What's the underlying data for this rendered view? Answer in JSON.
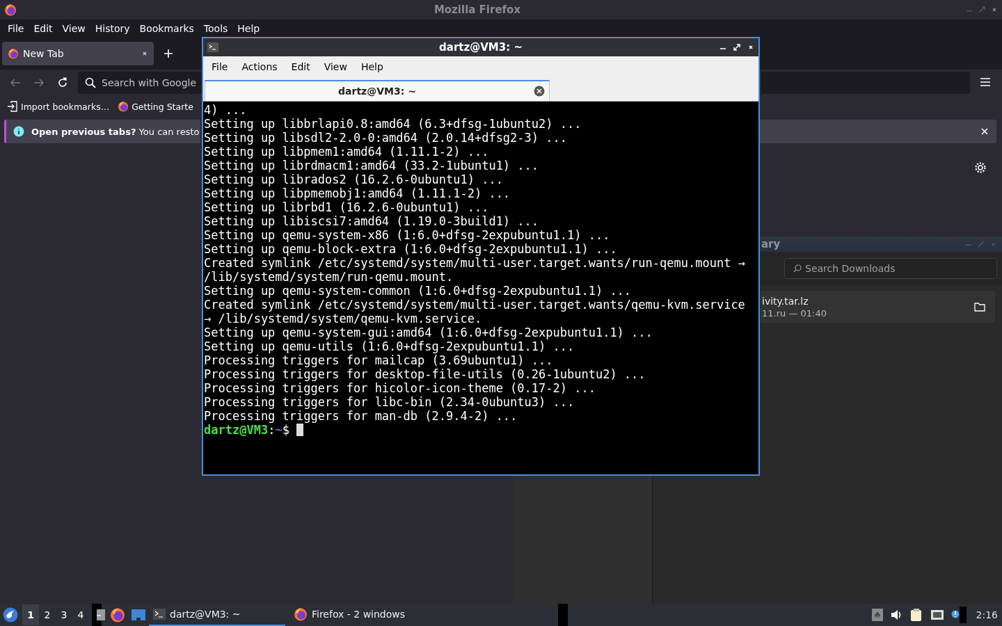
{
  "firefox": {
    "title": "Mozilla Firefox",
    "menu": [
      {
        "label": "File"
      },
      {
        "label": "Edit"
      },
      {
        "label": "View"
      },
      {
        "label": "History"
      },
      {
        "label": "Bookmarks"
      },
      {
        "label": "Tools"
      },
      {
        "label": "Help"
      }
    ],
    "tabs": [
      {
        "label": "New Tab",
        "selected": true
      }
    ],
    "url_placeholder": "Search with Google",
    "bookmarks": [
      {
        "label": "Import bookmarks…",
        "kind": "import"
      },
      {
        "label": "Getting Starte",
        "kind": "firefox"
      }
    ],
    "notification": "**Open previous tabs?** You can resto"
  },
  "library": {
    "title": "ary",
    "search_placeholder": "Search Downloads",
    "downloads": [
      {
        "name": "ivity.tar.lz",
        "detail": "11.ru — 01:40"
      }
    ]
  },
  "terminal": {
    "title": "dartz@VM3: ~",
    "menu": [
      {
        "label": "File"
      },
      {
        "label": "Actions"
      },
      {
        "label": "Edit"
      },
      {
        "label": "View"
      },
      {
        "label": "Help"
      }
    ],
    "tabs": [
      {
        "label": "dartz@VM3: ~",
        "selected": true
      }
    ],
    "lines": [
      "4) ...",
      "Setting up libbrlapi0.8:amd64 (6.3+dfsg-1ubuntu2) ...",
      "Setting up libsdl2-2.0-0:amd64 (2.0.14+dfsg2-3) ...",
      "Setting up libpmem1:amd64 (1.11.1-2) ...",
      "Setting up librdmacm1:amd64 (33.2-1ubuntu1) ...",
      "Setting up librados2 (16.2.6-0ubuntu1) ...",
      "Setting up libpmemobj1:amd64 (1.11.1-2) ...",
      "Setting up librbd1 (16.2.6-0ubuntu1) ...",
      "Setting up libiscsi7:amd64 (1.19.0-3build1) ...",
      "Setting up qemu-system-x86 (1:6.0+dfsg-2expubuntu1.1) ...",
      "Setting up qemu-block-extra (1:6.0+dfsg-2expubuntu1.1) ...",
      "Created symlink /etc/systemd/system/multi-user.target.wants/run-qemu.mount →",
      "/lib/systemd/system/run-qemu.mount.",
      "Setting up qemu-system-common (1:6.0+dfsg-2expubuntu1.1) ...",
      "Created symlink /etc/systemd/system/multi-user.target.wants/qemu-kvm.service",
      "→ /lib/systemd/system/qemu-kvm.service.",
      "Setting up qemu-system-gui:amd64 (1:6.0+dfsg-2expubuntu1.1) ...",
      "Setting up qemu-utils (1:6.0+dfsg-2expubuntu1.1) ...",
      "Processing triggers for mailcap (3.69ubuntu1) ...",
      "Processing triggers for desktop-file-utils (0.26-1ubuntu2) ...",
      "Processing triggers for hicolor-icon-theme (0.17-2) ...",
      "Processing triggers for libc-bin (2.34-0ubuntu3) ...",
      "Processing triggers for man-db (2.9.4-2) ..."
    ],
    "prompt": {
      "user": "dartz@VM3",
      "sep": ":",
      "path": "~",
      "symbol": "$"
    }
  },
  "taskbar": {
    "workspaces": [
      {
        "label": "1",
        "selected": true
      },
      {
        "label": "2",
        "selected": false
      },
      {
        "label": "3",
        "selected": false
      },
      {
        "label": "4",
        "selected": false
      }
    ],
    "tasks": [
      {
        "label": "dartz@VM3: ~",
        "kind": "terminal",
        "selected": true
      },
      {
        "label": "Firefox - 2 windows",
        "kind": "firefox",
        "selected": false
      }
    ],
    "clock": "2:16"
  }
}
